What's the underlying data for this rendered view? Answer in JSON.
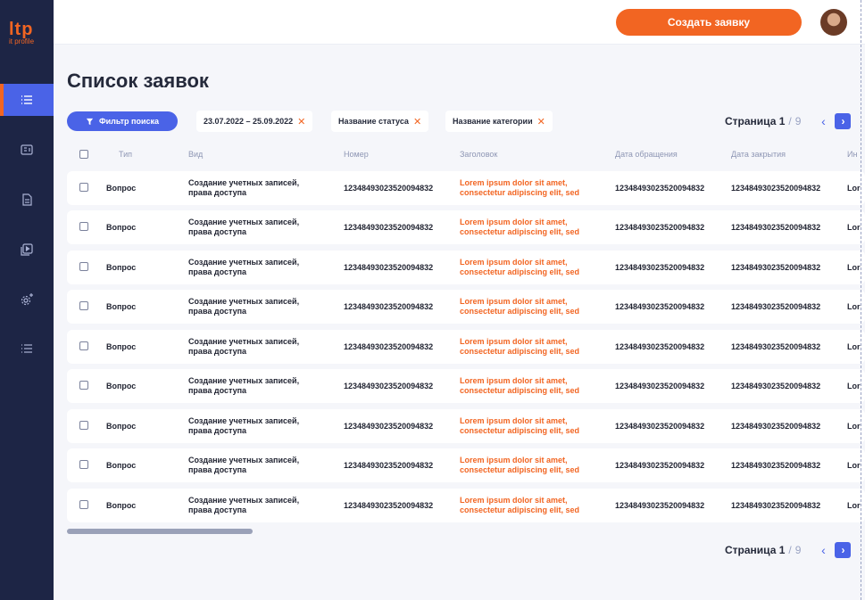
{
  "app": {
    "logo_main": "ltp",
    "logo_sub": "it profile"
  },
  "topbar": {
    "create_label": "Создать заявку"
  },
  "sidebar": {
    "items": [
      {
        "name": "list-icon",
        "active": true
      },
      {
        "name": "card-icon",
        "active": false
      },
      {
        "name": "document-icon",
        "active": false
      },
      {
        "name": "video-icon",
        "active": false
      },
      {
        "name": "settings-icon",
        "active": false
      },
      {
        "name": "list-bullets-icon",
        "active": false
      }
    ]
  },
  "page": {
    "title": "Список заявок"
  },
  "filters": {
    "button_label": "Фильтр поиска",
    "chips": [
      "23.07.2022 – 25.09.2022",
      "Название статуса",
      "Название категории"
    ]
  },
  "pager": {
    "label": "Страница",
    "current": "1",
    "separator": "/",
    "total": "9"
  },
  "table": {
    "columns": [
      "Тип",
      "Вид",
      "Номер",
      "Заголовок",
      "Дата обращения",
      "Дата закрытия",
      "Ин"
    ],
    "rows": [
      {
        "type": "Вопрос",
        "kind_1": "Создание учетных записей,",
        "kind_2": "права доступа",
        "number": "12348493023520094832",
        "heading_1": "Lorem ipsum dolor sit amet,",
        "heading_2": "consectetur adipiscing elit, sed",
        "date_open": "12348493023520094832",
        "date_close": "12348493023520094832",
        "more": "Lor"
      },
      {
        "type": "Вопрос",
        "kind_1": "Создание учетных записей,",
        "kind_2": "права доступа",
        "number": "12348493023520094832",
        "heading_1": "Lorem ipsum dolor sit amet,",
        "heading_2": "consectetur adipiscing elit, sed",
        "date_open": "12348493023520094832",
        "date_close": "12348493023520094832",
        "more": "Lor"
      },
      {
        "type": "Вопрос",
        "kind_1": "Создание учетных записей,",
        "kind_2": "права доступа",
        "number": "12348493023520094832",
        "heading_1": "Lorem ipsum dolor sit amet,",
        "heading_2": "consectetur adipiscing elit, sed",
        "date_open": "12348493023520094832",
        "date_close": "12348493023520094832",
        "more": "Lor"
      },
      {
        "type": "Вопрос",
        "kind_1": "Создание учетных записей,",
        "kind_2": "права доступа",
        "number": "12348493023520094832",
        "heading_1": "Lorem ipsum dolor sit amet,",
        "heading_2": "consectetur adipiscing elit, sed",
        "date_open": "12348493023520094832",
        "date_close": "12348493023520094832",
        "more": "Lor"
      },
      {
        "type": "Вопрос",
        "kind_1": "Создание учетных записей,",
        "kind_2": "права доступа",
        "number": "12348493023520094832",
        "heading_1": "Lorem ipsum dolor sit amet,",
        "heading_2": "consectetur adipiscing elit, sed",
        "date_open": "12348493023520094832",
        "date_close": "12348493023520094832",
        "more": "Lor"
      },
      {
        "type": "Вопрос",
        "kind_1": "Создание учетных записей,",
        "kind_2": "права доступа",
        "number": "12348493023520094832",
        "heading_1": "Lorem ipsum dolor sit amet,",
        "heading_2": "consectetur adipiscing elit, sed",
        "date_open": "12348493023520094832",
        "date_close": "12348493023520094832",
        "more": "Lor"
      },
      {
        "type": "Вопрос",
        "kind_1": "Создание учетных записей,",
        "kind_2": "права доступа",
        "number": "12348493023520094832",
        "heading_1": "Lorem ipsum dolor sit amet,",
        "heading_2": "consectetur adipiscing elit, sed",
        "date_open": "12348493023520094832",
        "date_close": "12348493023520094832",
        "more": "Lor"
      },
      {
        "type": "Вопрос",
        "kind_1": "Создание учетных записей,",
        "kind_2": "права доступа",
        "number": "12348493023520094832",
        "heading_1": "Lorem ipsum dolor sit amet,",
        "heading_2": "consectetur adipiscing elit, sed",
        "date_open": "12348493023520094832",
        "date_close": "12348493023520094832",
        "more": "Lor"
      },
      {
        "type": "Вопрос",
        "kind_1": "Создание учетных записей,",
        "kind_2": "права доступа",
        "number": "12348493023520094832",
        "heading_1": "Lorem ipsum dolor sit amet,",
        "heading_2": "consectetur adipiscing elit, sed",
        "date_open": "12348493023520094832",
        "date_close": "12348493023520094832",
        "more": "Lor"
      }
    ]
  },
  "colors": {
    "accent": "#4a63e7",
    "brand": "#f26522",
    "sidebar": "#1d2545"
  }
}
